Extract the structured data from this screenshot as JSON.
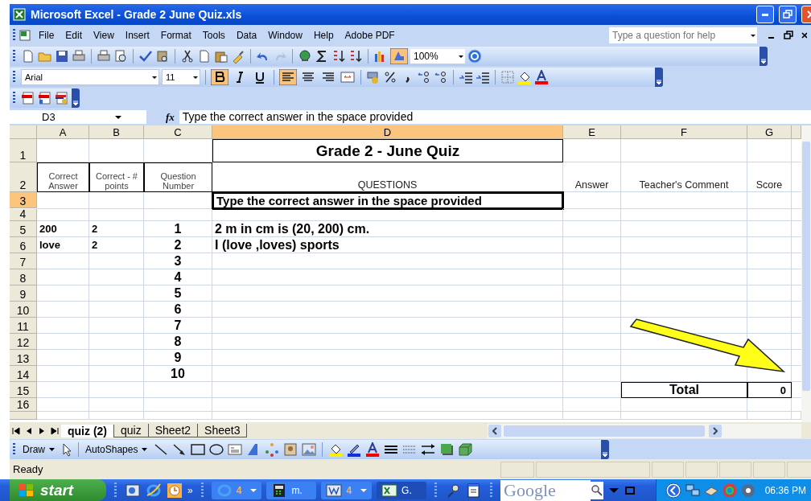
{
  "window": {
    "title": "Microsoft Excel - Grade 2 June Quiz.xls"
  },
  "menu": [
    "File",
    "Edit",
    "View",
    "Insert",
    "Format",
    "Tools",
    "Data",
    "Window",
    "Help",
    "Adobe PDF"
  ],
  "help_field": {
    "placeholder": "Type a question for help"
  },
  "standard_toolbar": {
    "zoom": "100%",
    "drawing_toggle_on": true
  },
  "formatting_toolbar": {
    "font": "Arial",
    "size": "11",
    "bold": true,
    "italic": false,
    "underline": false,
    "alignments": [
      {
        "selected": true
      },
      {
        "selected": false
      },
      {
        "selected": false
      }
    ]
  },
  "formula_bar": {
    "name_box": "D3",
    "fx": "fx",
    "formula": "Type the correct answer in the space provided"
  },
  "columns": [
    {
      "label": "A",
      "selected": false
    },
    {
      "label": "B",
      "selected": false
    },
    {
      "label": "C",
      "selected": false
    },
    {
      "label": "D",
      "selected": true
    },
    {
      "label": "E",
      "selected": false
    },
    {
      "label": "F",
      "selected": false
    },
    {
      "label": "G",
      "selected": false
    }
  ],
  "rows": [
    {
      "number": "1",
      "selected": false,
      "kind": "title",
      "cells": {
        "D": "Grade 2  -  June Quiz"
      }
    },
    {
      "number": "2",
      "selected": false,
      "kind": "header",
      "cells": {
        "A": "Correct Answer",
        "B": "Correct - # points",
        "C": "Question Number",
        "D": "QUESTIONS",
        "E": "Answer",
        "F": "Teacher's Comment",
        "G": "Score"
      }
    },
    {
      "number": "3",
      "selected": true,
      "kind": "instruction",
      "cells": {
        "D": "Type the correct answer in the space provided"
      }
    },
    {
      "number": "4",
      "selected": false,
      "kind": "blank",
      "cells": {}
    },
    {
      "number": "5",
      "selected": false,
      "kind": "question",
      "cells": {
        "A": "200",
        "B": "2",
        "C": "1",
        "D": "2 m in cm is (20, 200) cm."
      }
    },
    {
      "number": "6",
      "selected": false,
      "kind": "question",
      "cells": {
        "A": "love",
        "B": "2",
        "C": "2",
        "D": "I (love ,loves) sports"
      }
    },
    {
      "number": "7",
      "selected": false,
      "kind": "question",
      "cells": {
        "C": "3"
      }
    },
    {
      "number": "8",
      "selected": false,
      "kind": "question",
      "cells": {
        "C": "4"
      }
    },
    {
      "number": "9",
      "selected": false,
      "kind": "question",
      "cells": {
        "C": "5"
      }
    },
    {
      "number": "10",
      "selected": false,
      "kind": "question",
      "cells": {
        "C": "6"
      }
    },
    {
      "number": "11",
      "selected": false,
      "kind": "question",
      "cells": {
        "C": "7"
      }
    },
    {
      "number": "12",
      "selected": false,
      "kind": "question",
      "cells": {
        "C": "8"
      }
    },
    {
      "number": "13",
      "selected": false,
      "kind": "question",
      "cells": {
        "C": "9"
      }
    },
    {
      "number": "14",
      "selected": false,
      "kind": "question",
      "cells": {
        "C": "10"
      }
    },
    {
      "number": "15",
      "selected": false,
      "kind": "total",
      "cells": {
        "F": "Total",
        "G": "0"
      }
    },
    {
      "number": "16",
      "selected": false,
      "kind": "blank",
      "cells": {}
    }
  ],
  "sheet_tabs": [
    {
      "label": "quiz (2)",
      "selected": true
    },
    {
      "label": "quiz",
      "selected": false
    },
    {
      "label": "Sheet2",
      "selected": false
    },
    {
      "label": "Sheet3",
      "selected": false
    }
  ],
  "drawing_toolbar": {
    "draw": "Draw",
    "autoshapes": "AutoShapes"
  },
  "status_bar": {
    "text": "Ready"
  },
  "taskbar": {
    "start": "start",
    "quick_launch_more": "»",
    "tasks": [
      {
        "kind": "browser",
        "label": "4",
        "selected": false,
        "grouped": true
      },
      {
        "kind": "calculator",
        "label": "m.",
        "selected": false,
        "grouped": false
      },
      {
        "kind": "word",
        "label": "4",
        "selected": false,
        "grouped": true
      },
      {
        "kind": "excel",
        "label": "G.",
        "selected": true,
        "grouped": false
      }
    ],
    "search": {
      "placeholder": "Google"
    },
    "clock": "06:36 PM"
  }
}
